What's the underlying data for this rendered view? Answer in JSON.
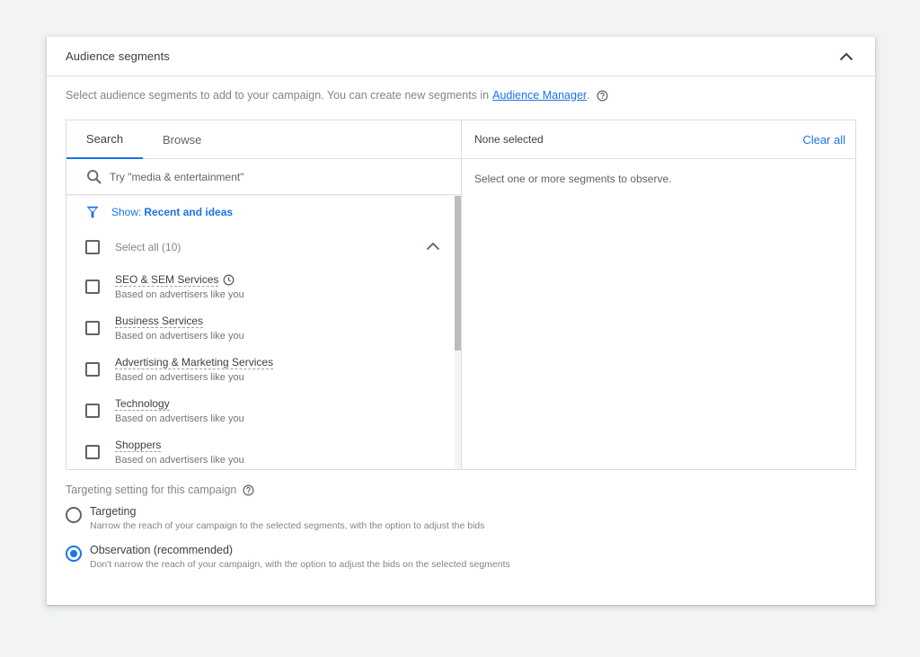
{
  "colors": {
    "accent": "#1a73e8",
    "background": "#f1f3f4",
    "text_primary": "#3c4043",
    "text_secondary": "#80868b"
  },
  "card": {
    "title": "Audience segments",
    "collapse_icon": "chevron-up-icon",
    "intro_text": "Select audience segments to add to your campaign. You can create new segments in",
    "intro_link": "Audience Manager",
    "intro_suffix": ".",
    "help_icon": "help-circle-icon"
  },
  "picker": {
    "tabs": [
      {
        "label": "Search",
        "active": true
      },
      {
        "label": "Browse",
        "active": false
      }
    ],
    "search": {
      "icon": "search-icon",
      "placeholder": "Try \"media & entertainment\"",
      "value": ""
    },
    "filter": {
      "icon": "filter-icon",
      "label": "Show:",
      "value": "Recent and ideas"
    },
    "select_all": {
      "label": "Select all (10)",
      "checked": false,
      "expand_icon": "chevron-up-icon"
    },
    "items": [
      {
        "name": "SEO & SEM Services",
        "sub": "Based on advertisers like you",
        "checked": false,
        "recent_icon": "clock-icon"
      },
      {
        "name": "Business Services",
        "sub": "Based on advertisers like you",
        "checked": false
      },
      {
        "name": "Advertising & Marketing Services",
        "sub": "Based on advertisers like you",
        "checked": false
      },
      {
        "name": "Technology",
        "sub": "Based on advertisers like you",
        "checked": false
      },
      {
        "name": "Shoppers",
        "sub": "Based on advertisers like you",
        "checked": false
      }
    ],
    "selected_panel": {
      "status": "None selected",
      "clear_label": "Clear all",
      "empty_message": "Select one or more segments to observe."
    }
  },
  "targeting": {
    "heading": "Targeting setting for this campaign",
    "help_icon": "help-circle-icon",
    "options": [
      {
        "title": "Targeting",
        "description": "Narrow the reach of your campaign to the selected segments, with the option to adjust the bids",
        "checked": false
      },
      {
        "title": "Observation (recommended)",
        "description": "Don't narrow the reach of your campaign, with the option to adjust the bids on the selected segments",
        "checked": true
      }
    ]
  }
}
